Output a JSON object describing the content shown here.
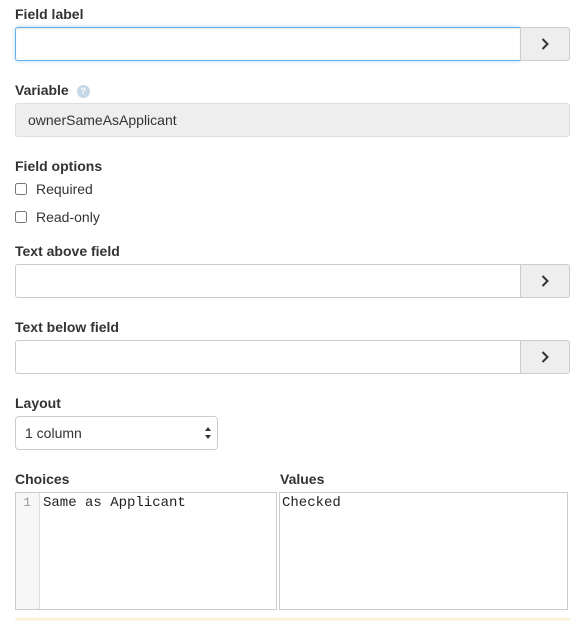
{
  "field_label": {
    "label": "Field label",
    "value": ""
  },
  "variable": {
    "label": "Variable",
    "help_icon": "question-icon",
    "help_glyph": "?",
    "value": "ownerSameAsApplicant"
  },
  "field_options": {
    "label": "Field options",
    "required": {
      "label": "Required",
      "checked": false
    },
    "read_only": {
      "label": "Read-only",
      "checked": false
    }
  },
  "text_above": {
    "label": "Text above field",
    "value": ""
  },
  "text_below": {
    "label": "Text below field",
    "value": ""
  },
  "layout": {
    "label": "Layout",
    "selected": "1 column"
  },
  "choices": {
    "label": "Choices",
    "line_number": "1",
    "text": "Same as Applicant"
  },
  "values": {
    "label": "Values",
    "text": "Checked"
  },
  "colors": {
    "focus_border": "#66afe9",
    "addon_bg": "#eeeeee"
  }
}
